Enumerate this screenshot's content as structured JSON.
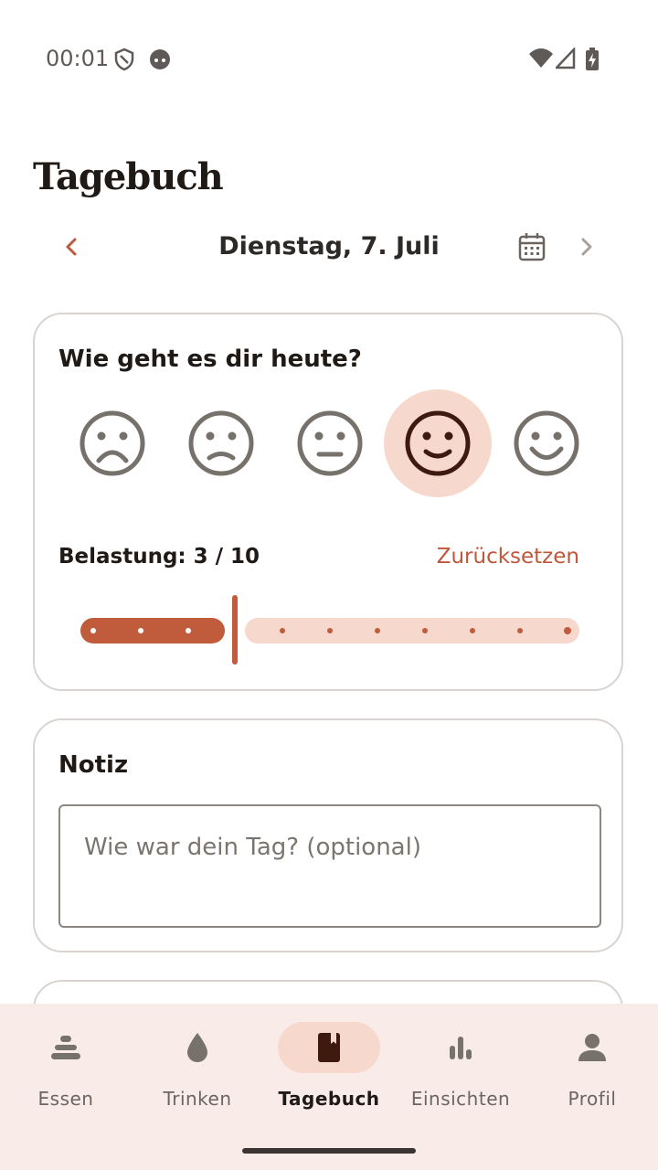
{
  "status": {
    "time": "00:01"
  },
  "header": {
    "title": "Tagebuch"
  },
  "date_nav": {
    "date": "Dienstag, 7. Juli"
  },
  "mood_card": {
    "question": "Wie geht es dir heute?",
    "moods": [
      "very-sad",
      "sad",
      "neutral",
      "happy",
      "very-happy"
    ],
    "selected_mood_index": 3,
    "stress_label": "Belastung: 3 / 10",
    "stress_value": 3,
    "stress_max": 10,
    "reset_label": "Zurücksetzen"
  },
  "note_card": {
    "title": "Notiz",
    "placeholder": "Wie war dein Tag? (optional)",
    "value": ""
  },
  "bottom_nav": {
    "items": [
      {
        "label": "Essen",
        "icon": "food-stack-icon"
      },
      {
        "label": "Trinken",
        "icon": "water-drop-icon"
      },
      {
        "label": "Tagebuch",
        "icon": "journal-icon"
      },
      {
        "label": "Einsichten",
        "icon": "bar-chart-icon"
      },
      {
        "label": "Profil",
        "icon": "person-icon"
      }
    ],
    "active_index": 2
  },
  "colors": {
    "accent": "#c0573a",
    "accent_light": "#f6d8cc",
    "nav_background": "#f9ece8"
  }
}
